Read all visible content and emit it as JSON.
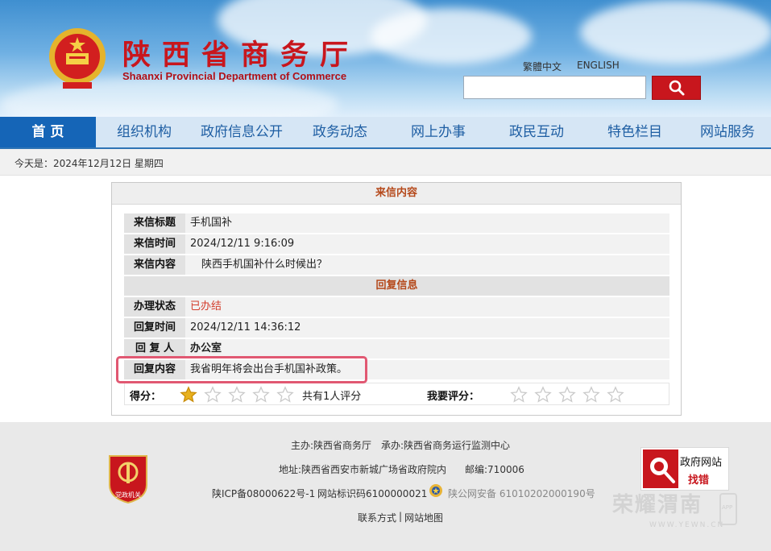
{
  "header": {
    "site_title": "陕西省商务厅",
    "site_subtitle": "Shaanxi Provincial Department of Commerce",
    "lang_traditional": "繁體中文",
    "lang_english": "ENGLISH",
    "search_value": ""
  },
  "nav": {
    "items": [
      {
        "label": "首 页"
      },
      {
        "label": "组织机构"
      },
      {
        "label": "政府信息公开"
      },
      {
        "label": "政务动态"
      },
      {
        "label": "网上办事"
      },
      {
        "label": "政民互动"
      },
      {
        "label": "特色栏目"
      },
      {
        "label": "网站服务"
      }
    ]
  },
  "datebar": {
    "text": "今天是：2024年12月12日 星期四"
  },
  "letter": {
    "panel_title": "来信内容",
    "title_label": "来信标题",
    "title_value": "手机国补",
    "time_label": "来信时间",
    "time_value": "2024/12/11 9:16:09",
    "content_label": "来信内容",
    "content_value": "陕西手机国补什么时候出？",
    "reply_section": "回复信息",
    "status_label": "办理状态",
    "status_value": "已办结",
    "reply_time_label": "回复时间",
    "reply_time_value": "2024/12/11 14:36:12",
    "replier_label": "回 复 人",
    "replier_value": "办公室",
    "reply_content_label": "回复内容",
    "reply_content_value": "我省明年将会出台手机国补政策。",
    "score_label": "得分：",
    "score_value": 1,
    "score_max": 5,
    "raters_text": "共有1人评分",
    "my_rating_label": "我要评分："
  },
  "colors": {
    "brand_red": "#c8161d",
    "nav_blue": "#1565b7",
    "section_orange": "#b5491b",
    "highlight_pink": "#e15872"
  },
  "footer": {
    "sponsor": "主办:陕西省商务厅",
    "organizer": "承办:陕西省商务运行监测中心",
    "address": "地址:陕西省西安市新城广场省政府院内",
    "postcode": "邮编:710006",
    "icp": "陕ICP备08000622号-1",
    "site_id": "网站标识码6100000021",
    "police": "陕公网安备 61010202000190号",
    "contact": "联系方式",
    "sitemap": "网站地图",
    "separator": "|",
    "badge_line1": "政府网站",
    "badge_line2": "找错",
    "party_badge": "党政机关",
    "watermark": "荣耀渭南",
    "watermark_sub": "WWW.YEWN.CN",
    "watermark_app": "APP"
  }
}
